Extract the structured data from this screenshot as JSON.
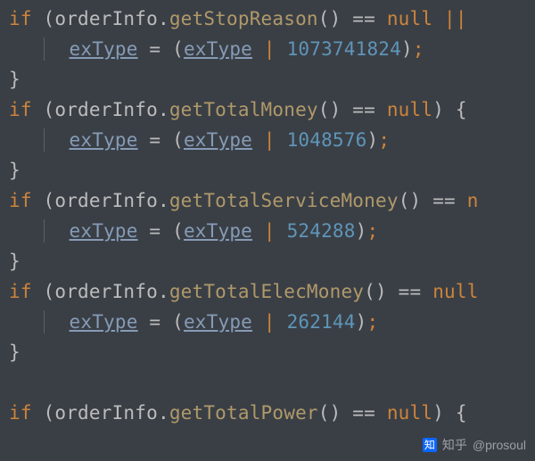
{
  "tokens": {
    "kw_if": "if",
    "obj": "orderInfo",
    "dot": ".",
    "lp": "(",
    "rp": ")",
    "dlp": "()",
    "eq": " == ",
    "null": "null",
    "or": " ||",
    "lbrace": " {",
    "rbrace": "}",
    "assign": " = ",
    "pipe": " | ",
    "semi": ";",
    "var_exType": "exType"
  },
  "blocks": [
    {
      "method": "getStopReason",
      "value": "1073741824",
      "tail": "or"
    },
    {
      "method": "getTotalMoney",
      "value": "1048576",
      "tail": "brace"
    },
    {
      "method": "getTotalServiceMoney",
      "value": "524288",
      "tail": "cut_n"
    },
    {
      "method": "getTotalElecMoney",
      "value": "262144",
      "tail": "null"
    },
    {
      "method": "getTotalPower",
      "value": "",
      "tail": "null_brace"
    }
  ],
  "watermark": {
    "logo": "知",
    "site": "知乎",
    "handle": "@prosoul"
  }
}
